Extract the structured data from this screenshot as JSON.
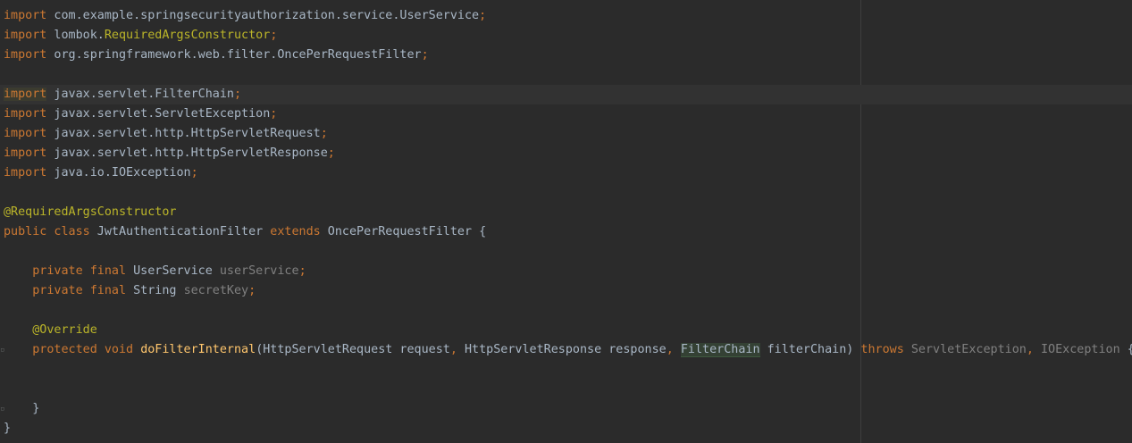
{
  "editor": {
    "lines": [
      {
        "parts": [
          [
            "kw",
            "import"
          ],
          [
            "plain",
            " com.example.springsecurityauthorization.service.UserService"
          ],
          [
            "kw",
            ";"
          ]
        ]
      },
      {
        "parts": [
          [
            "kw",
            "import"
          ],
          [
            "plain",
            " lombok."
          ],
          [
            "ann",
            "RequiredArgsConstructor"
          ],
          [
            "kw",
            ";"
          ]
        ]
      },
      {
        "parts": [
          [
            "kw",
            "import"
          ],
          [
            "plain",
            " org.springframework.web.filter.OncePerRequestFilter"
          ],
          [
            "kw",
            ";"
          ]
        ]
      },
      {
        "parts": []
      },
      {
        "parts": [
          [
            "kwhl",
            "import"
          ],
          [
            "plain",
            " javax.servlet.FilterChain"
          ],
          [
            "kw",
            ";"
          ]
        ],
        "current": true
      },
      {
        "parts": [
          [
            "kw",
            "import"
          ],
          [
            "plain",
            " javax.servlet.ServletException"
          ],
          [
            "kw",
            ";"
          ]
        ]
      },
      {
        "parts": [
          [
            "kw",
            "import"
          ],
          [
            "plain",
            " javax.servlet.http.HttpServletRequest"
          ],
          [
            "kw",
            ";"
          ]
        ]
      },
      {
        "parts": [
          [
            "kw",
            "import"
          ],
          [
            "plain",
            " javax.servlet.http.HttpServletResponse"
          ],
          [
            "kw",
            ";"
          ]
        ]
      },
      {
        "parts": [
          [
            "kw",
            "import"
          ],
          [
            "plain",
            " java.io.IOException"
          ],
          [
            "kw",
            ";"
          ]
        ]
      },
      {
        "parts": []
      },
      {
        "parts": [
          [
            "ann",
            "@RequiredArgsConstructor"
          ]
        ]
      },
      {
        "parts": [
          [
            "kw",
            "public class"
          ],
          [
            "plain",
            " JwtAuthenticationFilter "
          ],
          [
            "kw",
            "extends"
          ],
          [
            "plain",
            " OncePerRequestFilter {"
          ]
        ]
      },
      {
        "parts": []
      },
      {
        "parts": [
          [
            "plain",
            "    "
          ],
          [
            "kw",
            "private final"
          ],
          [
            "plain",
            " UserService "
          ],
          [
            "gray",
            "userService"
          ],
          [
            "kw",
            ";"
          ]
        ]
      },
      {
        "parts": [
          [
            "plain",
            "    "
          ],
          [
            "kw",
            "private final"
          ],
          [
            "plain",
            " String "
          ],
          [
            "gray",
            "secretKey"
          ],
          [
            "kw",
            ";"
          ]
        ]
      },
      {
        "parts": []
      },
      {
        "parts": [
          [
            "plain",
            "    "
          ],
          [
            "ann",
            "@Override"
          ]
        ]
      },
      {
        "parts": [
          [
            "plain",
            "    "
          ],
          [
            "kw",
            "protected void"
          ],
          [
            "plain",
            " "
          ],
          [
            "method",
            "doFilterInternal"
          ],
          [
            "plain",
            "(HttpServletRequest request"
          ],
          [
            "kw",
            ","
          ],
          [
            "plain",
            " HttpServletResponse response"
          ],
          [
            "kw",
            ","
          ],
          [
            "plain",
            " "
          ],
          [
            "hlword",
            "FilterChain"
          ],
          [
            "plain",
            " filterChain) "
          ],
          [
            "kw",
            "throws"
          ],
          [
            "plain",
            " "
          ],
          [
            "gray",
            "ServletException"
          ],
          [
            "kw",
            ","
          ],
          [
            "plain",
            " "
          ],
          [
            "gray",
            "IOException"
          ],
          [
            "plain",
            " {"
          ]
        ],
        "gutter": true
      },
      {
        "parts": []
      },
      {
        "parts": []
      },
      {
        "parts": [
          [
            "plain",
            "    }"
          ]
        ],
        "gutter": true
      },
      {
        "parts": [
          [
            "plain",
            "}"
          ]
        ]
      }
    ]
  }
}
